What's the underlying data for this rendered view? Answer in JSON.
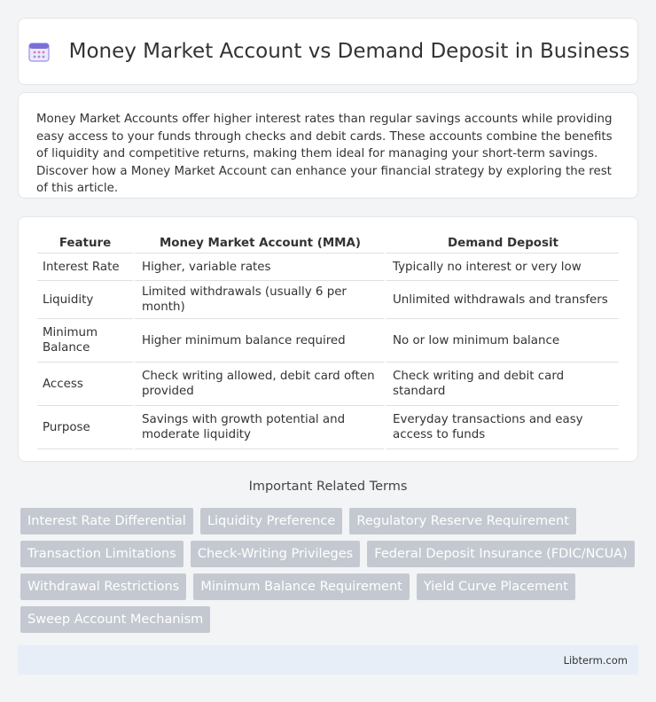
{
  "header": {
    "title": "Money Market Account vs Demand Deposit in Business",
    "icon": "calendar-icon"
  },
  "intro": {
    "text": "Money Market Accounts offer higher interest rates than regular savings accounts while providing easy access to your funds through checks and debit cards. These accounts combine the benefits of liquidity and competitive returns, making them ideal for managing your short-term savings. Discover how a Money Market Account can enhance your financial strategy by exploring the rest of this article."
  },
  "table": {
    "headers": [
      "Feature",
      "Money Market Account (MMA)",
      "Demand Deposit"
    ],
    "rows": [
      [
        "Interest Rate",
        "Higher, variable rates",
        "Typically no interest or very low"
      ],
      [
        "Liquidity",
        "Limited withdrawals (usually 6 per month)",
        "Unlimited withdrawals and transfers"
      ],
      [
        "Minimum Balance",
        "Higher minimum balance required",
        "No or low minimum balance"
      ],
      [
        "Access",
        "Check writing allowed, debit card often provided",
        "Check writing and debit card standard"
      ],
      [
        "Purpose",
        "Savings with growth potential and moderate liquidity",
        "Everyday transactions and easy access to funds"
      ]
    ]
  },
  "related": {
    "title": "Important Related Terms",
    "tags": [
      "Interest Rate Differential",
      "Liquidity Preference",
      "Regulatory Reserve Requirement",
      "Transaction Limitations",
      "Check-Writing Privileges",
      "Federal Deposit Insurance (FDIC/NCUA)",
      "Withdrawal Restrictions",
      "Minimum Balance Requirement",
      "Yield Curve Placement",
      "Sweep Account Mechanism"
    ]
  },
  "footer": {
    "site": "Libterm.com"
  },
  "colors": {
    "tag_bg": "#c4c9d1",
    "footer_bg": "#e8eef8",
    "icon_primary": "#7b6fd6"
  }
}
